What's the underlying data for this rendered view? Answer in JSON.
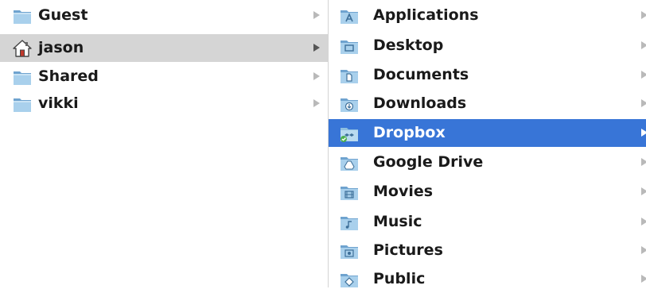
{
  "columns": {
    "users": {
      "items": [
        {
          "label": "Guest",
          "icon": "folder-icon"
        },
        {
          "label": "jason",
          "icon": "home-icon",
          "selected": "inactive"
        },
        {
          "label": "Shared",
          "icon": "folder-icon"
        },
        {
          "label": "vikki",
          "icon": "folder-icon"
        }
      ]
    },
    "home": {
      "items": [
        {
          "label": "Applications",
          "icon": "applications-folder-icon"
        },
        {
          "label": "Desktop",
          "icon": "desktop-folder-icon"
        },
        {
          "label": "Documents",
          "icon": "documents-folder-icon"
        },
        {
          "label": "Downloads",
          "icon": "downloads-folder-icon"
        },
        {
          "label": "Dropbox",
          "icon": "dropbox-folder-icon",
          "selected": "active"
        },
        {
          "label": "Google Drive",
          "icon": "google-drive-folder-icon"
        },
        {
          "label": "Movies",
          "icon": "movies-folder-icon"
        },
        {
          "label": "Music",
          "icon": "music-folder-icon"
        },
        {
          "label": "Pictures",
          "icon": "pictures-folder-icon"
        },
        {
          "label": "Public",
          "icon": "public-folder-icon"
        }
      ]
    }
  },
  "colors": {
    "selection_active": "#3875d7",
    "selection_inactive": "#d5d5d5",
    "folder_blue": "#8fbfe0"
  }
}
